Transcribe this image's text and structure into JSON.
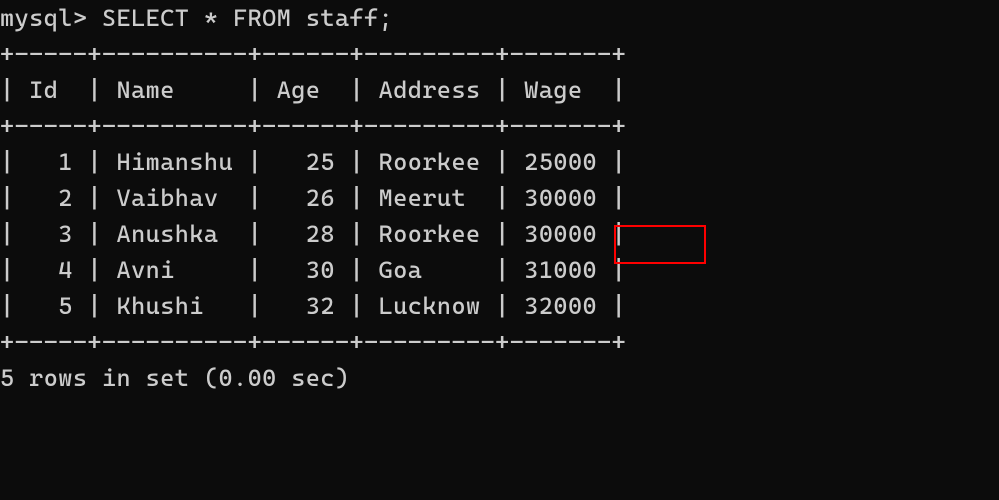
{
  "prompt": "mysql>",
  "query": "SELECT * FROM staff;",
  "columns": [
    "Id",
    "Name",
    "Age",
    "Address",
    "Wage"
  ],
  "border_top": "+-----+----------+------+---------+-------+",
  "header_row": "| Id  | Name     | Age  | Address | Wage  |",
  "border_mid": "+-----+----------+------+---------+-------+",
  "rows": [
    "|   1 | Himanshu |   25 | Roorkee | 25000 |",
    "|   2 | Vaibhav  |   26 | Meerut  | 30000 |",
    "|   3 | Anushka  |   28 | Roorkee | 30000 |",
    "|   4 | Avni     |   30 | Goa     | 31000 |",
    "|   5 | Khushi   |   32 | Lucknow | 32000 |"
  ],
  "border_bot": "+-----+----------+------+---------+-------+",
  "result_msg": "5 rows in set (0.00 sec)",
  "chart_data": {
    "type": "table",
    "columns": [
      "Id",
      "Name",
      "Age",
      "Address",
      "Wage"
    ],
    "data": [
      [
        1,
        "Himanshu",
        25,
        "Roorkee",
        25000
      ],
      [
        2,
        "Vaibhav",
        26,
        "Meerut",
        30000
      ],
      [
        3,
        "Anushka",
        28,
        "Roorkee",
        30000
      ],
      [
        4,
        "Avni",
        30,
        "Goa",
        31000
      ],
      [
        5,
        "Khushi",
        32,
        "Lucknow",
        32000
      ]
    ]
  },
  "highlight": {
    "row_index": 1,
    "column": "Wage"
  }
}
